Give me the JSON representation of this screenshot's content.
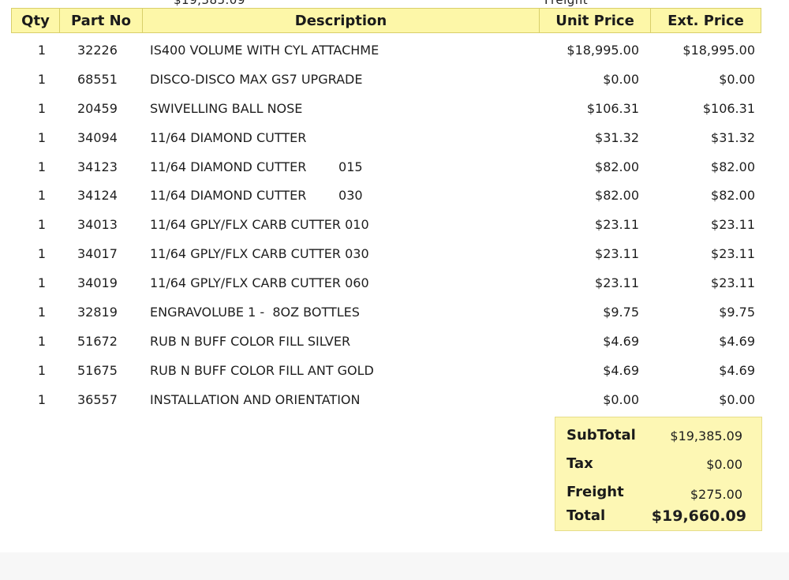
{
  "cutoff": {
    "left": "$19,385.09",
    "right": "Freight"
  },
  "header": {
    "qty": "Qty",
    "part_no": "Part No",
    "description": "Description",
    "unit_price": "Unit Price",
    "ext_price": "Ext. Price"
  },
  "rows": [
    {
      "qty": "1",
      "part": "32226",
      "desc": "IS400 VOLUME WITH CYL ATTACHME",
      "unit": "$18,995.00",
      "ext": "$18,995.00"
    },
    {
      "qty": "1",
      "part": "68551",
      "desc": "DISCO-DISCO MAX GS7 UPGRADE",
      "unit": "$0.00",
      "ext": "$0.00"
    },
    {
      "qty": "1",
      "part": "20459",
      "desc": "SWIVELLING BALL NOSE",
      "unit": "$106.31",
      "ext": "$106.31"
    },
    {
      "qty": "1",
      "part": "34094",
      "desc": "11/64 DIAMOND CUTTER",
      "unit": "$31.32",
      "ext": "$31.32"
    },
    {
      "qty": "1",
      "part": "34123",
      "desc": "11/64 DIAMOND CUTTER        015",
      "unit": "$82.00",
      "ext": "$82.00"
    },
    {
      "qty": "1",
      "part": "34124",
      "desc": "11/64 DIAMOND CUTTER        030",
      "unit": "$82.00",
      "ext": "$82.00"
    },
    {
      "qty": "1",
      "part": "34013",
      "desc": "11/64 GPLY/FLX CARB CUTTER 010",
      "unit": "$23.11",
      "ext": "$23.11"
    },
    {
      "qty": "1",
      "part": "34017",
      "desc": "11/64 GPLY/FLX CARB CUTTER 030",
      "unit": "$23.11",
      "ext": "$23.11"
    },
    {
      "qty": "1",
      "part": "34019",
      "desc": "11/64 GPLY/FLX CARB CUTTER 060",
      "unit": "$23.11",
      "ext": "$23.11"
    },
    {
      "qty": "1",
      "part": "32819",
      "desc": "ENGRAVOLUBE 1 -  8OZ BOTTLES",
      "unit": "$9.75",
      "ext": "$9.75"
    },
    {
      "qty": "1",
      "part": "51672",
      "desc": "RUB N BUFF COLOR FILL SILVER",
      "unit": "$4.69",
      "ext": "$4.69"
    },
    {
      "qty": "1",
      "part": "51675",
      "desc": "RUB N BUFF COLOR FILL ANT GOLD",
      "unit": "$4.69",
      "ext": "$4.69"
    },
    {
      "qty": "1",
      "part": "36557",
      "desc": "INSTALLATION AND ORIENTATION",
      "unit": "$0.00",
      "ext": "$0.00"
    }
  ],
  "totals": {
    "subtotal_label": "SubTotal",
    "subtotal": "$19,385.09",
    "tax_label": "Tax",
    "tax": "$0.00",
    "freight_label": "Freight",
    "freight": "$275.00",
    "total_label": "Total",
    "total": "$19,660.09"
  },
  "colors": {
    "header_bg": "#fdf7a8",
    "totals_bg": "#fdf7b4"
  }
}
